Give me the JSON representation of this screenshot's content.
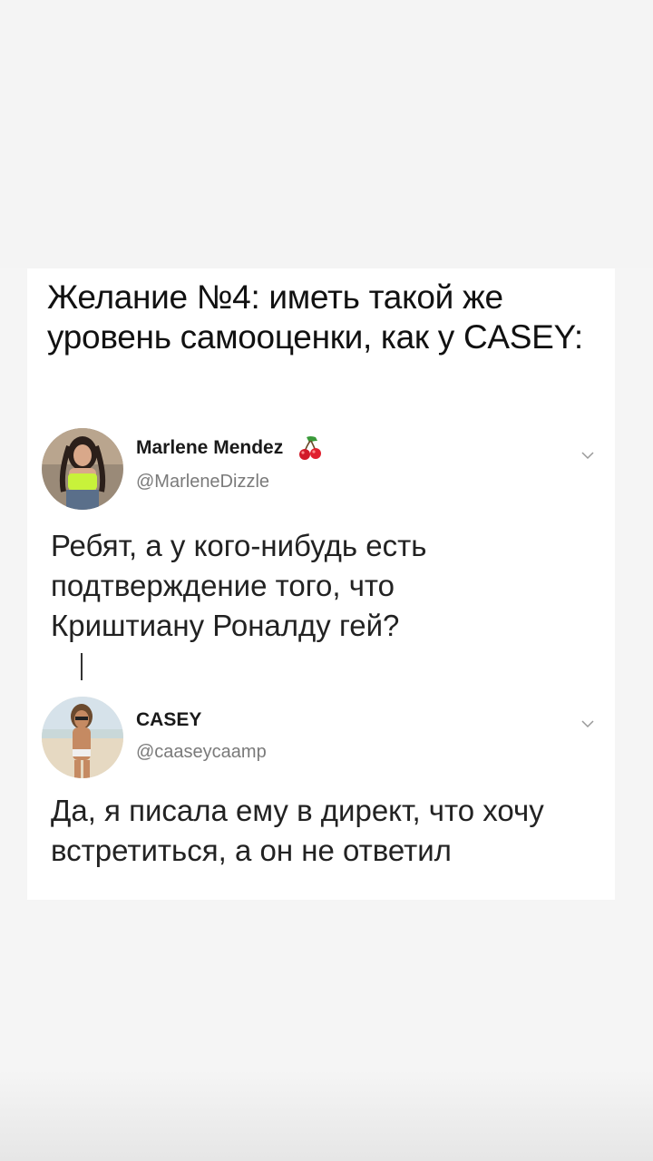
{
  "headline": "Желание №4: иметь такой же уровень самооценки, как у CASEY:",
  "tweets": [
    {
      "name": "Marlene Mendez",
      "handle": "@MarleneDizzle",
      "emoji": "cherry-icon",
      "text": "Ребят, а у кого-нибудь есть подтверждение того, что Криштиану Роналду гей?"
    },
    {
      "name": "CASEY",
      "handle": "@caaseycaamp",
      "text": "Да, я писала ему в директ, что хочу встретиться, а он не ответил"
    }
  ],
  "colors": {
    "background": "#f5f5f5",
    "card": "#ffffff",
    "text": "#222222",
    "handle": "#7a7a7a"
  }
}
